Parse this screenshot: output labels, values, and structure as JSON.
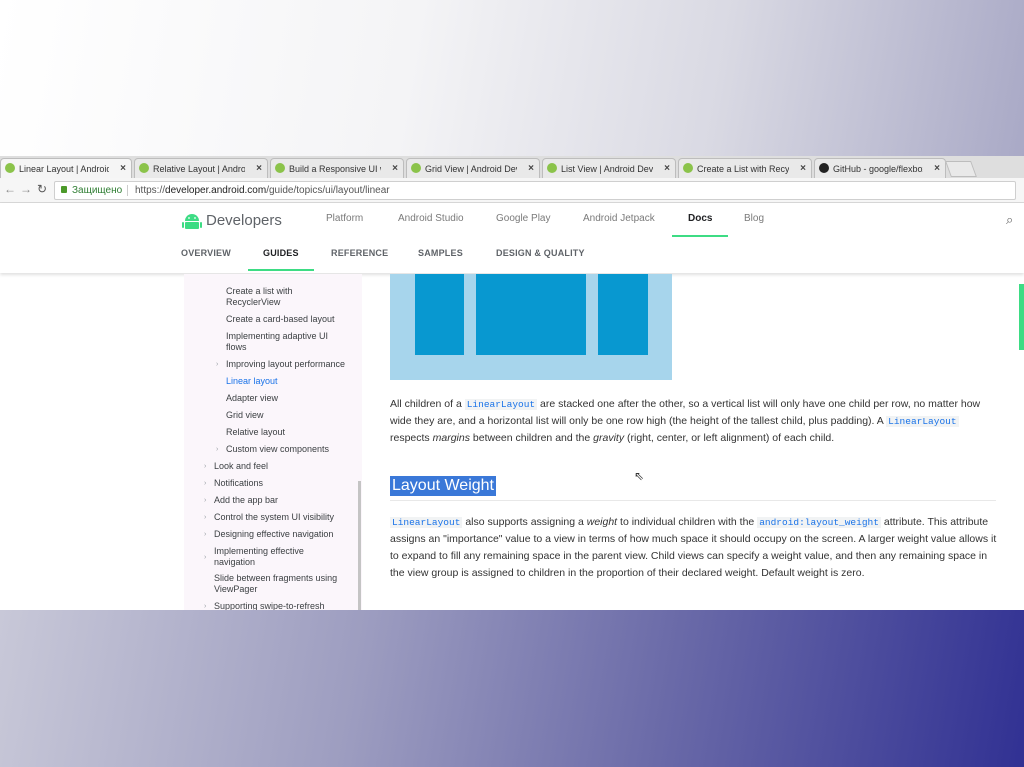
{
  "browser": {
    "tabs": [
      {
        "title": "Linear Layout | Android",
        "favicon": "android-icon",
        "active": true
      },
      {
        "title": "Relative Layout | Andro",
        "favicon": "android-icon",
        "active": false
      },
      {
        "title": "Build a Responsive UI wi",
        "favicon": "android-icon",
        "active": false
      },
      {
        "title": "Grid View | Android Dev",
        "favicon": "android-icon",
        "active": false
      },
      {
        "title": "List View | Android Dev",
        "favicon": "android-icon",
        "active": false
      },
      {
        "title": "Create a List with Recycl",
        "favicon": "android-icon",
        "active": false
      },
      {
        "title": "GitHub - google/flexbox",
        "favicon": "github-icon",
        "active": false
      }
    ],
    "tab_close": "×",
    "secure_label": "Защищено",
    "url_prefix": "https://",
    "url_host": "developer.android.com",
    "url_path": "/guide/topics/ui/layout/linear"
  },
  "header": {
    "brand": "Developers",
    "nav": [
      "Platform",
      "Android Studio",
      "Google Play",
      "Android Jetpack",
      "Docs",
      "Blog"
    ],
    "active_nav": "Docs",
    "subnav": [
      "OVERVIEW",
      "GUIDES",
      "REFERENCE",
      "SAMPLES",
      "DESIGN & QUALITY"
    ],
    "active_subnav": "GUIDES"
  },
  "sidebar": {
    "items": [
      {
        "label": "Create a list with RecyclerView",
        "level": 2
      },
      {
        "label": "Create a card-based layout",
        "level": 2
      },
      {
        "label": "Implementing adaptive UI flows",
        "level": 2
      },
      {
        "label": "Improving layout performance",
        "level": 2,
        "expandable": true
      },
      {
        "label": "Linear layout",
        "level": 2,
        "active": true
      },
      {
        "label": "Adapter view",
        "level": 2
      },
      {
        "label": "Grid view",
        "level": 2
      },
      {
        "label": "Relative layout",
        "level": 2
      },
      {
        "label": "Custom view components",
        "level": 2,
        "expandable": true
      },
      {
        "label": "Look and feel",
        "level": 1,
        "expandable": true
      },
      {
        "label": "Notifications",
        "level": 1,
        "expandable": true
      },
      {
        "label": "Add the app bar",
        "level": 1,
        "expandable": true
      },
      {
        "label": "Control the system UI visibility",
        "level": 1,
        "expandable": true
      },
      {
        "label": "Designing effective navigation",
        "level": 1,
        "expandable": true
      },
      {
        "label": "Implementing effective navigation",
        "level": 1,
        "expandable": true
      },
      {
        "label": "Slide between fragments using ViewPager",
        "level": 1
      },
      {
        "label": "Supporting swipe-to-refresh",
        "level": 1,
        "expandable": true
      }
    ]
  },
  "content": {
    "para1": {
      "t1": "All children of a ",
      "c1": "LinearLayout",
      "t2": " are stacked one after the other, so a vertical list will only have one child per row, no matter how wide they are, and a horizontal list will only be one row high (the height of the tallest child, plus padding). A ",
      "c2": "LinearLayout",
      "t3": " respects ",
      "e1": "margins",
      "t4": " between children and the ",
      "e2": "gravity",
      "t5": " (right, center, or left alignment) of each child."
    },
    "heading": "Layout Weight",
    "para2": {
      "c1": "LinearLayout",
      "t1": " also supports assigning a ",
      "e1": "weight",
      "t2": " to individual children with the ",
      "c2": "android:layout_weight",
      "t3": " attribute. This attribute assigns an \"importance\" value to a view in terms of how much space it should occupy on the screen. A larger weight value allows it to expand to fill any remaining space in the parent view. Child views can specify a weight value, and then any remaining space in the view group is assigned to children in the proportion of their declared weight. Default weight is zero."
    }
  },
  "colors": {
    "accent_green": "#3ddc84",
    "link_blue": "#1a73e8",
    "diagram_bg": "#a7d5ec",
    "diagram_box": "#0898d0",
    "selection": "#3a78d8"
  }
}
